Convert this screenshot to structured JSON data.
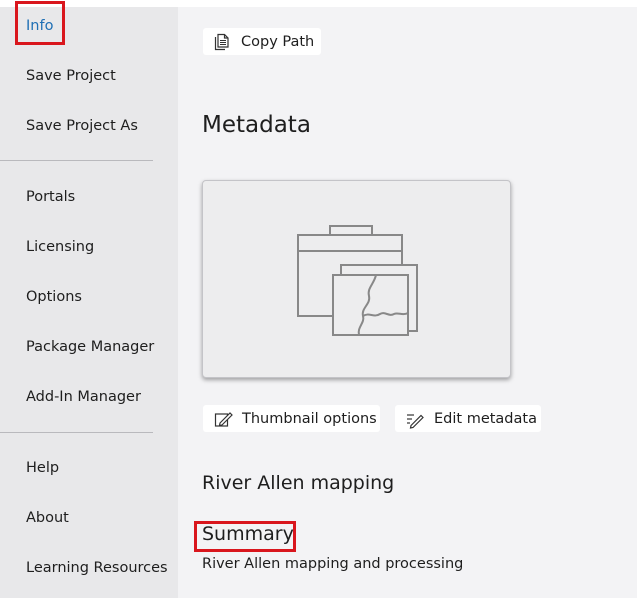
{
  "sidebar": {
    "items": [
      {
        "label": "Info",
        "active": true
      },
      {
        "label": "Save Project"
      },
      {
        "label": "Save Project As"
      },
      {
        "label": "Portals"
      },
      {
        "label": "Licensing"
      },
      {
        "label": "Options"
      },
      {
        "label": "Package Manager"
      },
      {
        "label": "Add-In Manager"
      },
      {
        "label": "Help"
      },
      {
        "label": "About"
      },
      {
        "label": "Learning Resources"
      }
    ]
  },
  "main": {
    "copy_path_label": "Copy Path",
    "metadata_title": "Metadata",
    "thumbnail_icon": "map-folder-icon",
    "thumbnail_options_label": "Thumbnail options",
    "edit_metadata_label": "Edit metadata",
    "project_title": "River Allen mapping",
    "summary_heading": "Summary",
    "summary_text": "River Allen mapping and processing"
  },
  "colors": {
    "sidebar_bg": "#e8e8ea",
    "main_bg": "#f3f3f5",
    "active_link": "#1f6fb5",
    "highlight_box": "#d9161d"
  }
}
